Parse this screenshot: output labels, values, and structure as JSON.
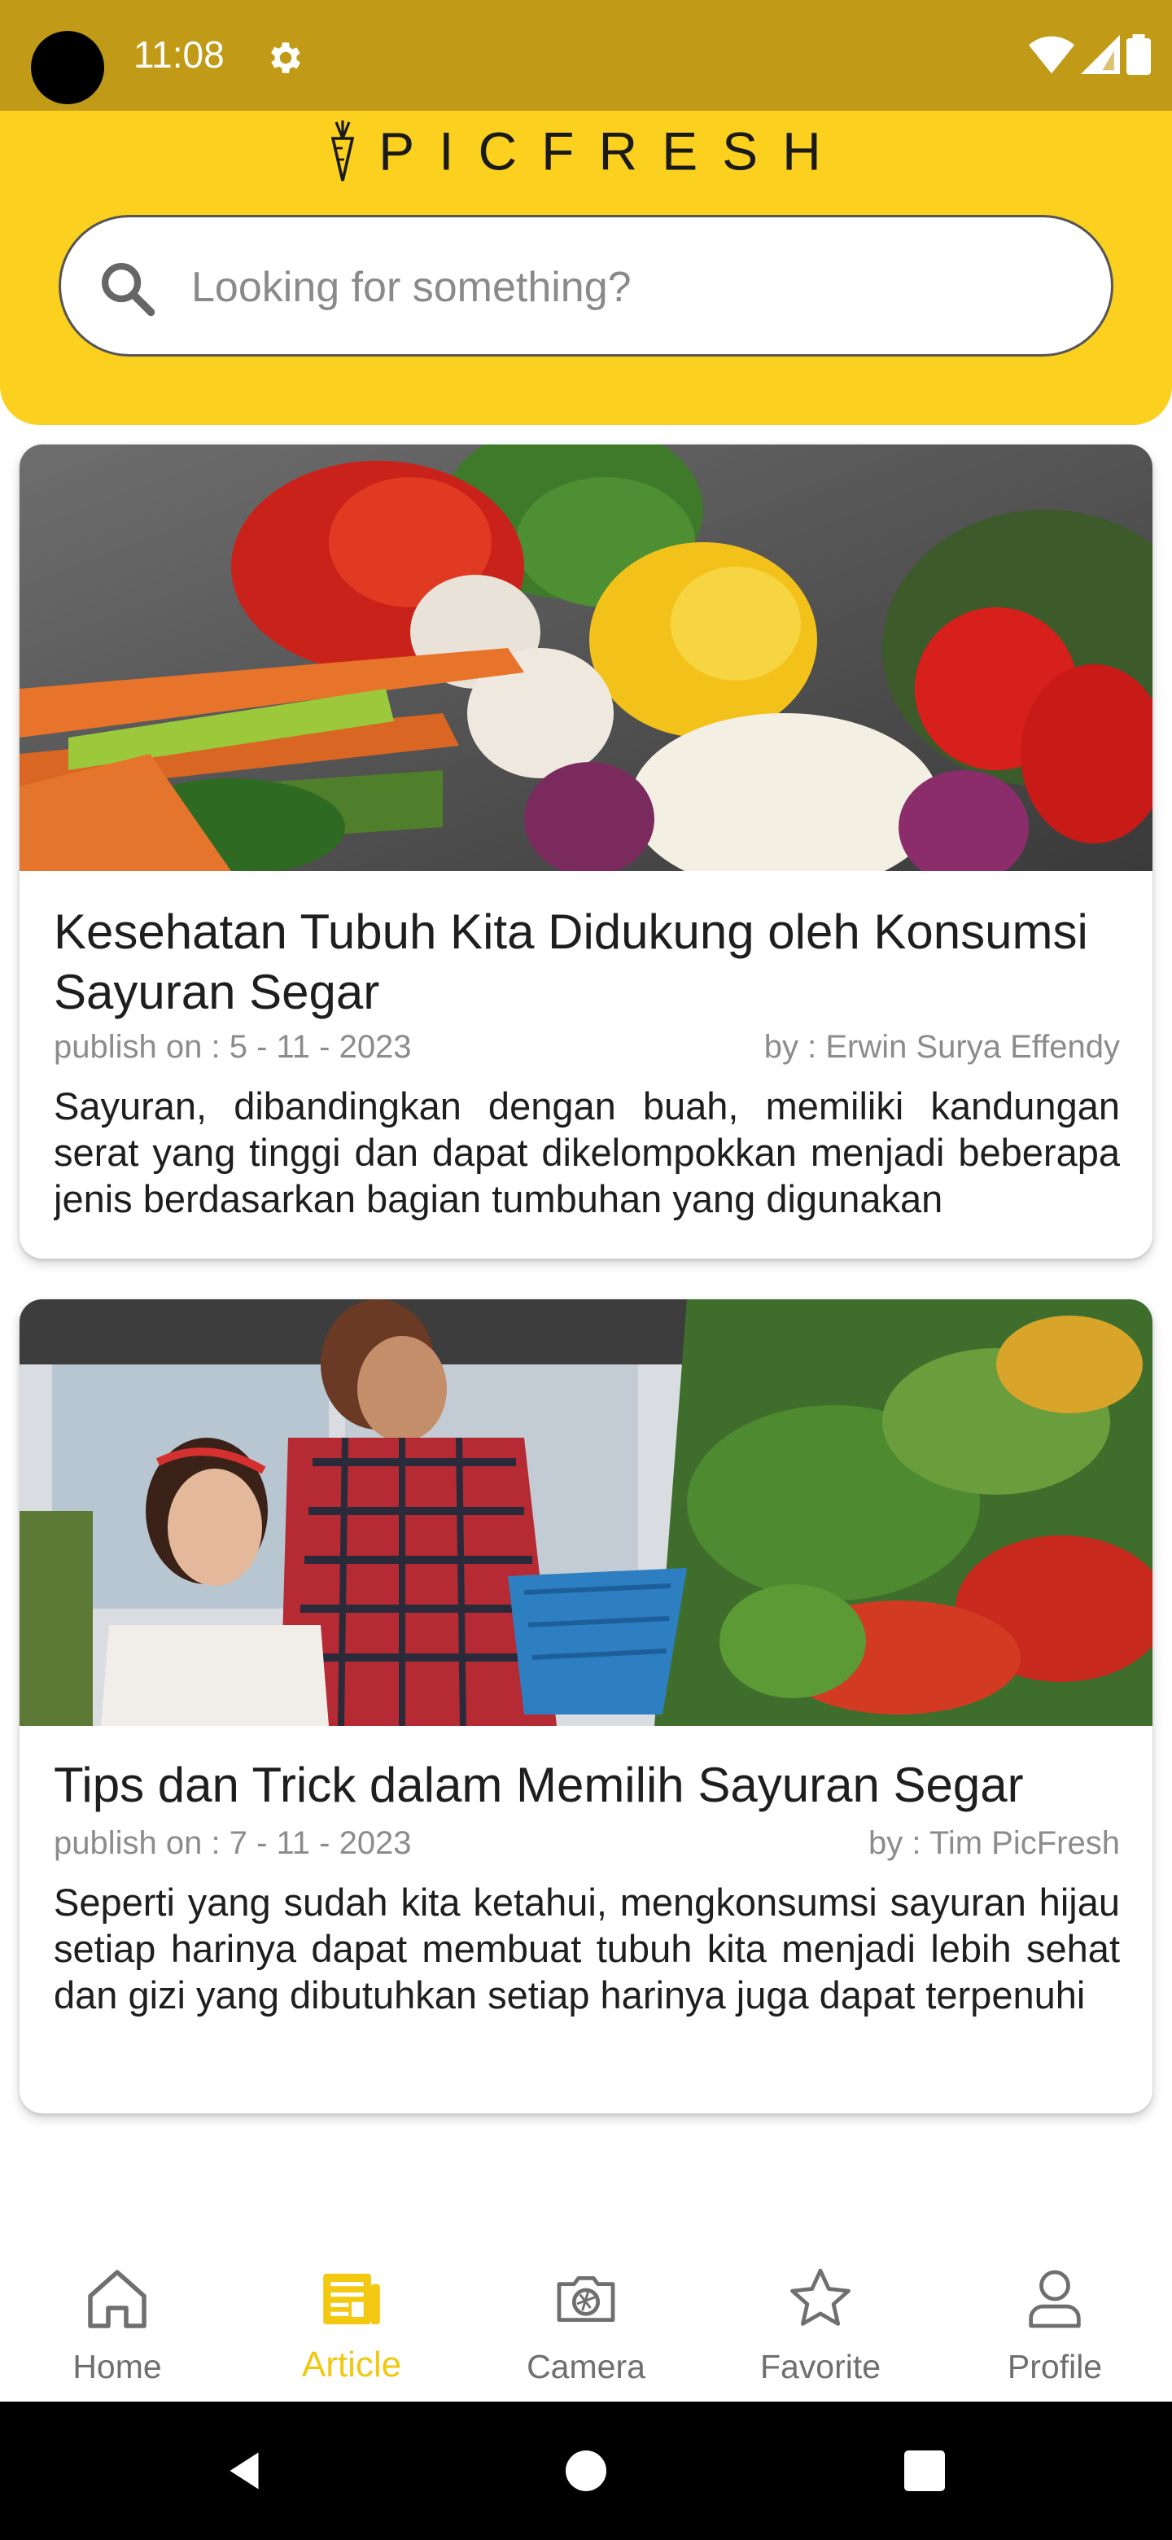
{
  "status_bar": {
    "time": "11:08",
    "icons": [
      "settings-icon",
      "wifi-icon",
      "signal-icon",
      "battery-icon"
    ]
  },
  "header": {
    "logo_text": "PICFRESH",
    "search_placeholder": "Looking for something?",
    "background_color": "#FBD01F"
  },
  "articles": [
    {
      "title": "Kesehatan Tubuh Kita Didukung oleh Konsumsi Sayuran Segar",
      "date": "publish on : 5 - 11 - 2023",
      "author": "by : Erwin Surya Effendy",
      "excerpt": "Sayuran, dibandingkan dengan buah, memiliki kandungan serat yang tinggi dan dapat dikelompokkan menjadi beberapa jenis berdasarkan bagian tumbuhan yang digunakan",
      "image": "vegetables-photo"
    },
    {
      "title": "Tips dan Trick dalam Memilih Sayuran Segar",
      "date": "publish on : 7 - 11 - 2023",
      "author": "by : Tim PicFresh",
      "excerpt": "Seperti yang sudah kita ketahui, mengkonsumsi sayuran hijau setiap harinya dapat membuat tubuh kita menjadi lebih sehat dan gizi yang dibutuhkan setiap harinya juga dapat terpenuhi",
      "image": "shopping-photo"
    }
  ],
  "bottom_nav": {
    "active": "Article",
    "accent_color": "#F2C811",
    "items": [
      {
        "label": "Home",
        "icon": "home-icon"
      },
      {
        "label": "Article",
        "icon": "article-icon"
      },
      {
        "label": "Camera",
        "icon": "camera-icon"
      },
      {
        "label": "Favorite",
        "icon": "star-icon"
      },
      {
        "label": "Profile",
        "icon": "profile-icon"
      }
    ]
  }
}
